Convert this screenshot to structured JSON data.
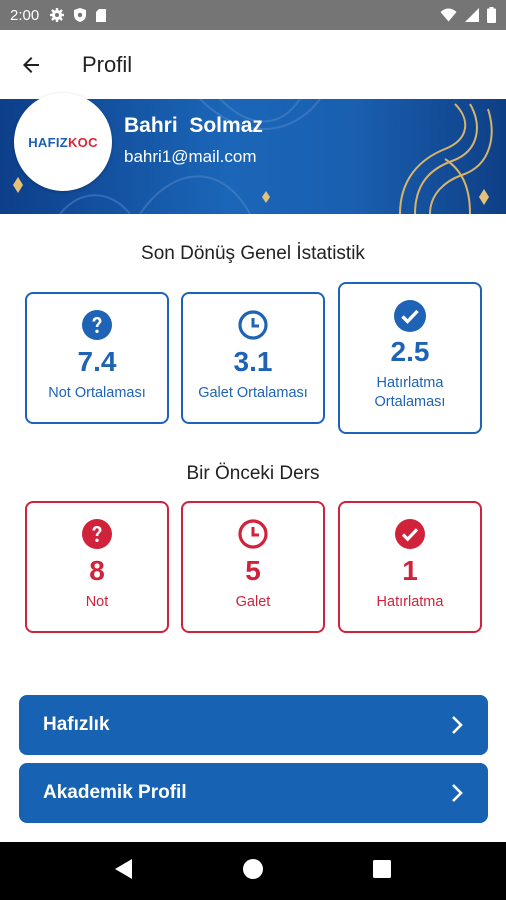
{
  "status_bar": {
    "time": "2:00",
    "left_icons": [
      "gear-icon",
      "shield-icon",
      "sd-card-icon"
    ],
    "right_icons": [
      "wifi-icon",
      "signal-icon",
      "battery-icon"
    ]
  },
  "app_bar": {
    "title": "Profil",
    "back_icon": "arrow-left-icon"
  },
  "profile": {
    "name": "Bahri  Solmaz",
    "email": "bahri1@mail.com",
    "logo_part1": "HAFIZ",
    "logo_part2": "KOC"
  },
  "general_stats": {
    "title": "Son Dönüş Genel İstatistik",
    "items": [
      {
        "icon": "question-circle-icon",
        "value": "7.4",
        "label": "Not Ortalaması"
      },
      {
        "icon": "clock-icon",
        "value": "3.1",
        "label": "Galet Ortalaması"
      },
      {
        "icon": "check-circle-icon",
        "value": "2.5",
        "label": "Hatırlatma Ortalaması"
      }
    ]
  },
  "previous_lesson": {
    "title": "Bir Önceki Ders",
    "items": [
      {
        "icon": "question-circle-icon",
        "value": "8",
        "label": "Not"
      },
      {
        "icon": "clock-icon",
        "value": "5",
        "label": "Galet"
      },
      {
        "icon": "check-circle-icon",
        "value": "1",
        "label": "Hatırlatma"
      }
    ]
  },
  "menu": [
    {
      "label": "Hafızlık",
      "icon": "chevron-right-icon"
    },
    {
      "label": "Akademik Profil",
      "icon": "chevron-right-icon"
    }
  ],
  "colors": {
    "primary_blue": "#1e63b5",
    "accent_red": "#d0233b",
    "button_blue": "#1762b2"
  }
}
